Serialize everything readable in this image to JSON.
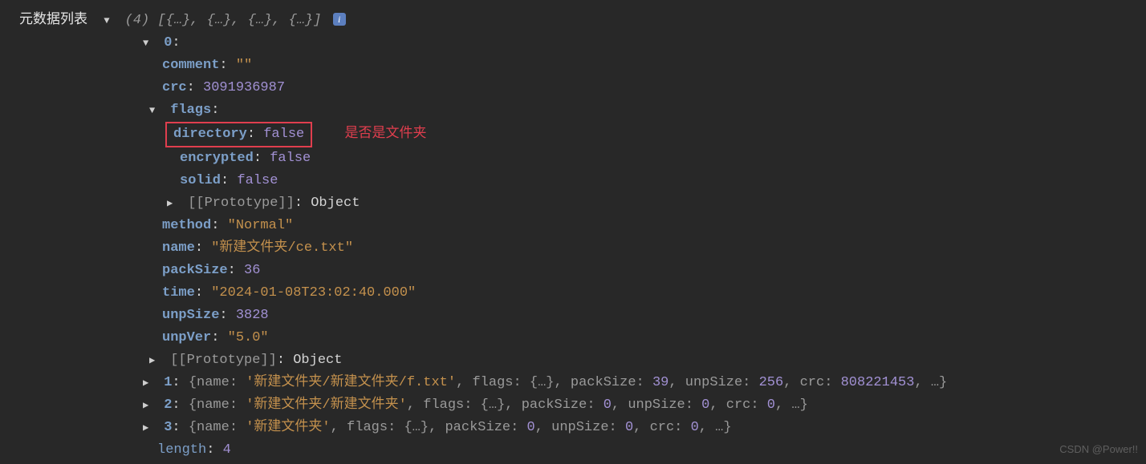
{
  "rootLabel": "元数据列表",
  "arrayCount": "(4)",
  "arrayPreview": "[{…}, {…}, {…}, {…}]",
  "obj0": {
    "index": "0",
    "comment": {
      "key": "comment",
      "value": "\"\""
    },
    "crc": {
      "key": "crc",
      "value": "3091936987"
    },
    "flagsKey": "flags",
    "flags": {
      "directory": {
        "key": "directory",
        "value": "false"
      },
      "encrypted": {
        "key": "encrypted",
        "value": "false"
      },
      "solid": {
        "key": "solid",
        "value": "false"
      }
    },
    "protoLabel": "[[Prototype]]",
    "protoVal": "Object",
    "method": {
      "key": "method",
      "value": "\"Normal\""
    },
    "name": {
      "key": "name",
      "value": "\"新建文件夹/ce.txt\""
    },
    "packSize": {
      "key": "packSize",
      "value": "36"
    },
    "time": {
      "key": "time",
      "value": "\"2024-01-08T23:02:40.000\""
    },
    "unpSize": {
      "key": "unpSize",
      "value": "3828"
    },
    "unpVer": {
      "key": "unpVer",
      "value": "\"5.0\""
    }
  },
  "obj1": {
    "index": "1",
    "name": "'新建文件夹/新建文件夹/f.txt'",
    "packSize": "39",
    "unpSize": "256",
    "crc": "808221453"
  },
  "obj2": {
    "index": "2",
    "name": "'新建文件夹/新建文件夹'",
    "packSize": "0",
    "unpSize": "0",
    "crc": "0"
  },
  "obj3": {
    "index": "3",
    "name": "'新建文件夹'",
    "packSize": "0",
    "unpSize": "0",
    "crc": "0"
  },
  "lengthKey": "length",
  "lengthVal": "4",
  "annotation": "是否是文件夹",
  "watermark": "CSDN @Power!!",
  "summaryLabels": {
    "name": "name",
    "flags": "flags",
    "flagsVal": "{…}",
    "packSize": "packSize",
    "unpSize": "unpSize",
    "crc": "crc"
  }
}
